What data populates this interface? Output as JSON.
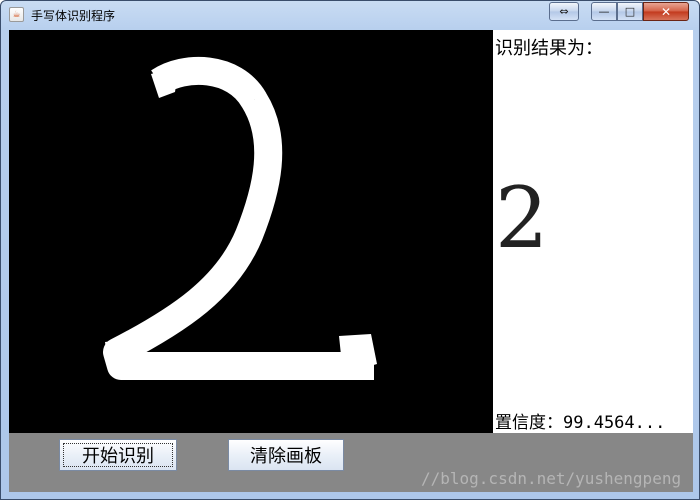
{
  "window": {
    "title": "手写体识别程序",
    "controls": {
      "resize_glyph": "⇔",
      "minimize_glyph": "—",
      "maximize_glyph": "□",
      "close_glyph": "✕"
    }
  },
  "canvas": {
    "background": "#000000",
    "stroke_color": "#ffffff",
    "drawn_digit": "2"
  },
  "result": {
    "label": "识别结果为：",
    "digit": "2",
    "confidence": "置信度：99.4564..."
  },
  "buttons": {
    "start": "开始识别",
    "clear": "清除画板"
  },
  "watermark": "//blog.csdn.net/yushengpeng"
}
